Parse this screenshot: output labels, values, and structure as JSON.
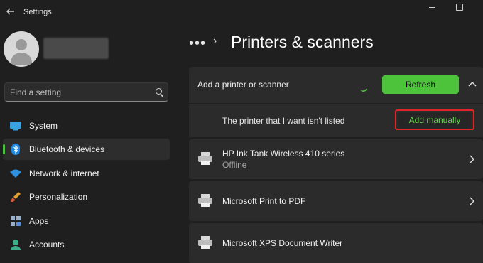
{
  "window": {
    "title": "Settings"
  },
  "search": {
    "placeholder": "Find a setting"
  },
  "sidebar": {
    "items": [
      {
        "label": "System",
        "icon": "system-icon",
        "active": false
      },
      {
        "label": "Bluetooth & devices",
        "icon": "bluetooth-icon",
        "active": true
      },
      {
        "label": "Network & internet",
        "icon": "wifi-icon",
        "active": false
      },
      {
        "label": "Personalization",
        "icon": "brush-icon",
        "active": false
      },
      {
        "label": "Apps",
        "icon": "apps-icon",
        "active": false
      },
      {
        "label": "Accounts",
        "icon": "accounts-icon",
        "active": false
      }
    ]
  },
  "breadcrumb": {
    "more": "•••",
    "separator": "›"
  },
  "page": {
    "title": "Printers & scanners"
  },
  "add_printer": {
    "label": "Add a printer or scanner",
    "refresh_label": "Refresh",
    "not_listed_label": "The printer that I want isn't listed",
    "add_manually_label": "Add manually"
  },
  "printers": [
    {
      "name": "HP Ink Tank Wireless 410 series",
      "status": "Offline"
    },
    {
      "name": "Microsoft Print to PDF",
      "status": ""
    },
    {
      "name": "Microsoft XPS Document Writer",
      "status": ""
    }
  ],
  "colors": {
    "accent": "#4cc33a",
    "accent_text": "#66d64f",
    "highlight": "#e0242a",
    "background": "#1f1f1f",
    "card": "#2b2b2b"
  }
}
